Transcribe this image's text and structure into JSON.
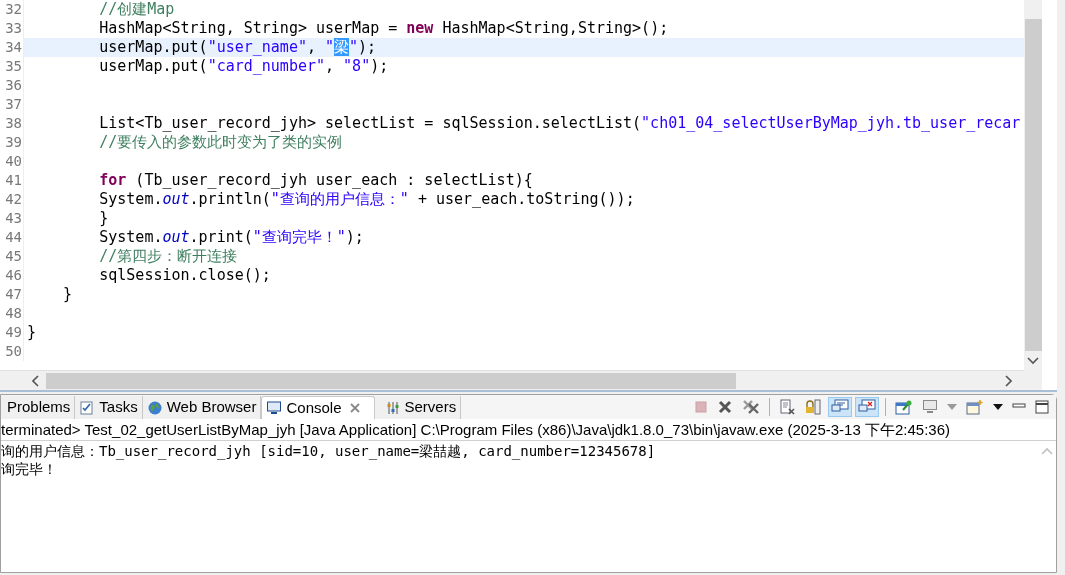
{
  "editor": {
    "lines": [
      {
        "number": "32",
        "current": false,
        "segments": [
          {
            "kind": "comment",
            "text": "        //创建Map"
          }
        ]
      },
      {
        "number": "33",
        "current": false,
        "segments": [
          {
            "kind": "plain",
            "text": "        HashMap<String, String> userMap = "
          },
          {
            "kind": "keyword",
            "text": "new"
          },
          {
            "kind": "plain",
            "text": " HashMap<String,String>();"
          }
        ]
      },
      {
        "number": "34",
        "current": true,
        "segments": [
          {
            "kind": "plain",
            "text": "        userMap.put("
          },
          {
            "kind": "string",
            "text": "\"user_name\""
          },
          {
            "kind": "plain",
            "text": ", "
          },
          {
            "kind": "string",
            "text": "\""
          },
          {
            "kind": "selection",
            "text": "梁"
          },
          {
            "kind": "string",
            "text": "\""
          },
          {
            "kind": "plain",
            "text": ");"
          }
        ]
      },
      {
        "number": "35",
        "current": false,
        "segments": [
          {
            "kind": "plain",
            "text": "        userMap.put("
          },
          {
            "kind": "string",
            "text": "\"card_number\""
          },
          {
            "kind": "plain",
            "text": ", "
          },
          {
            "kind": "string",
            "text": "\"8\""
          },
          {
            "kind": "plain",
            "text": ");"
          }
        ]
      },
      {
        "number": "36",
        "current": false
      },
      {
        "number": "37",
        "current": false
      },
      {
        "number": "38",
        "current": false,
        "segments": [
          {
            "kind": "plain",
            "text": "        List<Tb_user_record_jyh> selectList = sqlSession.selectList("
          },
          {
            "kind": "string",
            "text": "\"ch01_04_selectUserByMap_jyh.tb_user_recar"
          }
        ]
      },
      {
        "number": "39",
        "current": false,
        "segments": [
          {
            "kind": "comment",
            "text": "        //要传入的参数此时变为了类的实例"
          }
        ]
      },
      {
        "number": "40",
        "current": false
      },
      {
        "number": "41",
        "current": false,
        "segments": [
          {
            "kind": "keyword",
            "text": "        for"
          },
          {
            "kind": "plain",
            "text": " (Tb_user_record_jyh user_each : selectList){"
          }
        ]
      },
      {
        "number": "42",
        "current": false,
        "segments": [
          {
            "kind": "plain",
            "text": "        System."
          },
          {
            "kind": "static",
            "text": "out"
          },
          {
            "kind": "plain",
            "text": ".println("
          },
          {
            "kind": "string",
            "text": "\"查询的用户信息：\""
          },
          {
            "kind": "plain",
            "text": " + user_each.toString());"
          }
        ]
      },
      {
        "number": "43",
        "current": false,
        "segments": [
          {
            "kind": "plain",
            "text": "        }"
          }
        ]
      },
      {
        "number": "44",
        "current": false,
        "segments": [
          {
            "kind": "plain",
            "text": "        System."
          },
          {
            "kind": "static",
            "text": "out"
          },
          {
            "kind": "plain",
            "text": ".print("
          },
          {
            "kind": "string",
            "text": "\"查询完毕！\""
          },
          {
            "kind": "plain",
            "text": ");"
          }
        ]
      },
      {
        "number": "45",
        "current": false,
        "segments": [
          {
            "kind": "comment",
            "text": "        //第四步：断开连接"
          }
        ]
      },
      {
        "number": "46",
        "current": false,
        "segments": [
          {
            "kind": "plain",
            "text": "        sqlSession.close();"
          }
        ]
      },
      {
        "number": "47",
        "current": false,
        "segments": [
          {
            "kind": "plain",
            "text": "    }"
          }
        ]
      },
      {
        "number": "48",
        "current": false
      },
      {
        "number": "49",
        "current": false,
        "segments": [
          {
            "kind": "plain",
            "text": "}"
          }
        ]
      },
      {
        "number": "50",
        "current": false
      }
    ]
  },
  "panel": {
    "tabs": [
      {
        "kind": "problems",
        "label": "Problems",
        "selected": false
      },
      {
        "kind": "tasks",
        "label": "Tasks",
        "selected": false
      },
      {
        "kind": "browser",
        "label": "Web Browser",
        "selected": false
      },
      {
        "kind": "console",
        "label": "Console",
        "selected": true
      },
      {
        "kind": "servers",
        "label": "Servers",
        "selected": false
      }
    ],
    "toolbar_groups": [
      {
        "buttons": [
          {
            "kind": "terminate",
            "on": false
          },
          {
            "kind": "remove",
            "on": false
          },
          {
            "kind": "remove_all",
            "on": false
          }
        ]
      },
      {
        "buttons": [
          {
            "kind": "clear",
            "on": false
          },
          {
            "kind": "scroll_lock",
            "on": false
          },
          {
            "kind": "show_out",
            "on": true
          },
          {
            "kind": "show_err",
            "on": true
          }
        ]
      },
      {
        "buttons": [
          {
            "kind": "pin",
            "on": false
          },
          {
            "kind": "display",
            "on": false
          },
          {
            "kind": "dropdown",
            "on": false
          },
          {
            "kind": "open_console",
            "on": false
          },
          {
            "kind": "dropdown",
            "on": false
          },
          {
            "kind": "minimize",
            "on": false
          },
          {
            "kind": "maximize",
            "on": false
          }
        ]
      }
    ],
    "header": "terminated> Test_02_getUserListByMap_jyh [Java Application] C:\\Program Files (x86)\\Java\\jdk1.8.0_73\\bin\\javaw.exe (2025-3-13 下午2:45:36)",
    "output": [
      "询的用户信息：Tb_user_record_jyh [sid=10, user_name=梁喆越, card_number=12345678]",
      "询完毕！"
    ]
  }
}
